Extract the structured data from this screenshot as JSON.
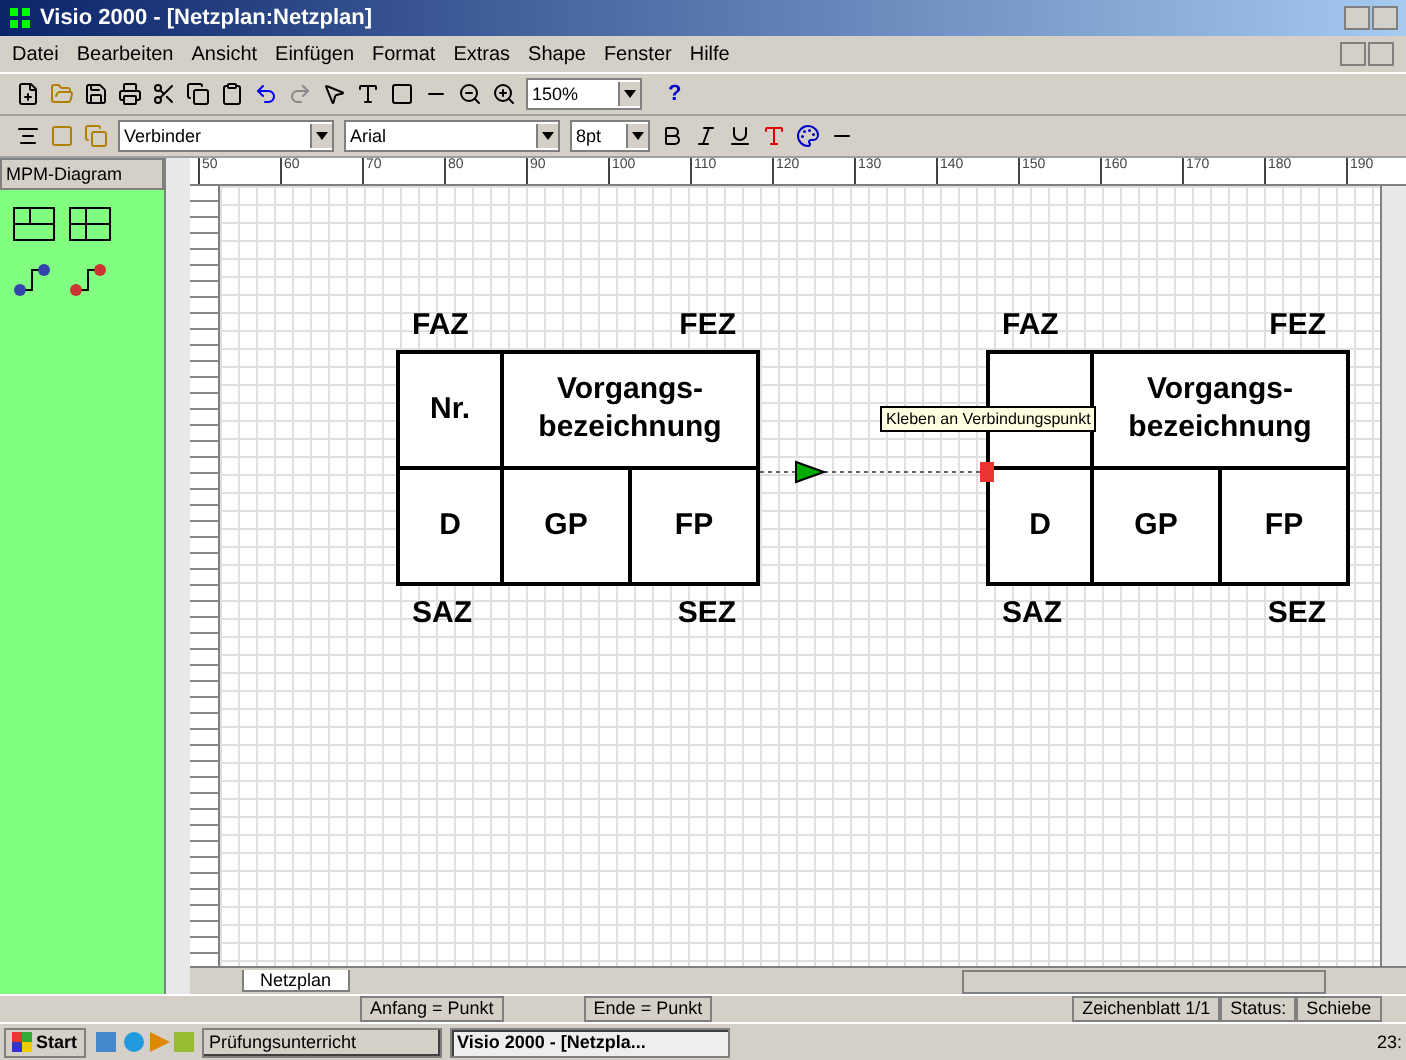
{
  "window": {
    "title": "Visio 2000 - [Netzplan:Netzplan]"
  },
  "menu": [
    "Datei",
    "Bearbeiten",
    "Ansicht",
    "Einfügen",
    "Format",
    "Extras",
    "Shape",
    "Fenster",
    "Hilfe"
  ],
  "toolbar": {
    "zoom": "150%",
    "style": "Verbinder",
    "font": "Arial",
    "size": "8pt",
    "help": "?"
  },
  "stencil": {
    "title": "MPM-Diagram"
  },
  "ruler": [
    "50",
    "60",
    "70",
    "80",
    "90",
    "100",
    "110",
    "120",
    "130",
    "140",
    "150",
    "160",
    "170",
    "180",
    "190"
  ],
  "nodes": [
    {
      "top_left": "FAZ",
      "top_right": "FEZ",
      "number": "Nr.",
      "name": "Vorgangs-bezeichnung",
      "duration": "D",
      "gp": "GP",
      "fp": "FP",
      "bottom_left": "SAZ",
      "bottom_right": "SEZ"
    },
    {
      "top_left": "FAZ",
      "top_right": "FEZ",
      "name": "Vorgangs-bezeichnung",
      "duration": "D",
      "gp": "GP",
      "fp": "FP",
      "bottom_left": "SAZ",
      "bottom_right": "SEZ"
    }
  ],
  "tooltip": "Kleben an Verbindungspunkt",
  "sheet_tab": "Netzplan",
  "status_bar": [
    "Anfang = Punkt",
    "Ende = Punkt",
    "Zeichenblatt 1/1",
    "Status:",
    "Schiebe"
  ],
  "taskbar": {
    "start": "Start",
    "tasks": [
      {
        "label": "Prüfungsunterricht",
        "selected": false
      },
      {
        "label": "Visio 2000 - [Netzpla...",
        "selected": true
      }
    ],
    "clock": "23:"
  }
}
